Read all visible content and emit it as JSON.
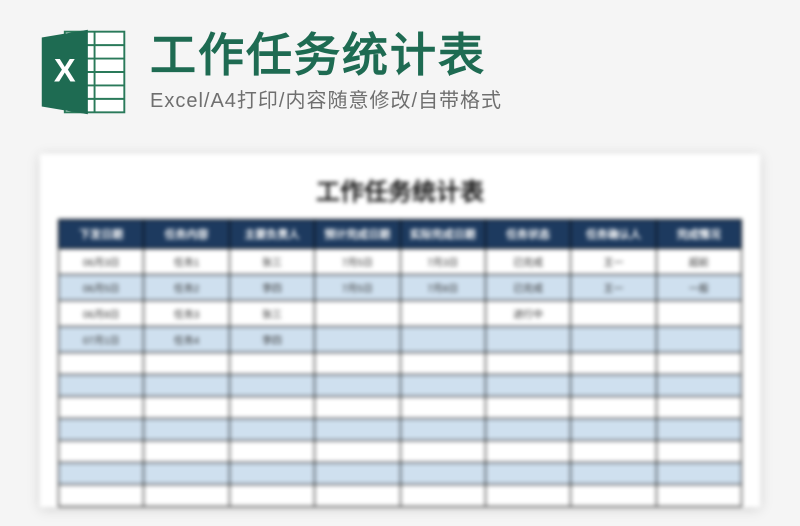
{
  "header": {
    "title": "工作任务统计表",
    "subtitle": "Excel/A4打印/内容随意修改/自带格式",
    "icon_label": "X"
  },
  "sheet": {
    "title": "工作任务统计表"
  },
  "chart_data": {
    "type": "table",
    "columns": [
      "下发日期",
      "任务内容",
      "主要负责人",
      "预计完成日期",
      "实际完成日期",
      "任务状态",
      "任务确认人",
      "完成情况"
    ],
    "rows": [
      [
        "06月3日",
        "任务1",
        "张三",
        "7月5日",
        "7月3日",
        "已完成",
        "王一",
        "超前"
      ],
      [
        "06月5日",
        "任务2",
        "李四",
        "7月5日",
        "7月8日",
        "已完成",
        "王一",
        "一般"
      ],
      [
        "06月8日",
        "任务3",
        "张三",
        "",
        "",
        "进行中",
        "",
        ""
      ],
      [
        "07月1日",
        "任务4",
        "李四",
        "",
        "",
        "",
        "",
        ""
      ],
      [
        "",
        "",
        "",
        "",
        "",
        "",
        "",
        ""
      ],
      [
        "",
        "",
        "",
        "",
        "",
        "",
        "",
        ""
      ],
      [
        "",
        "",
        "",
        "",
        "",
        "",
        "",
        ""
      ],
      [
        "",
        "",
        "",
        "",
        "",
        "",
        "",
        ""
      ],
      [
        "",
        "",
        "",
        "",
        "",
        "",
        "",
        ""
      ],
      [
        "",
        "",
        "",
        "",
        "",
        "",
        "",
        ""
      ],
      [
        "",
        "",
        "",
        "",
        "",
        "",
        "",
        ""
      ]
    ]
  }
}
